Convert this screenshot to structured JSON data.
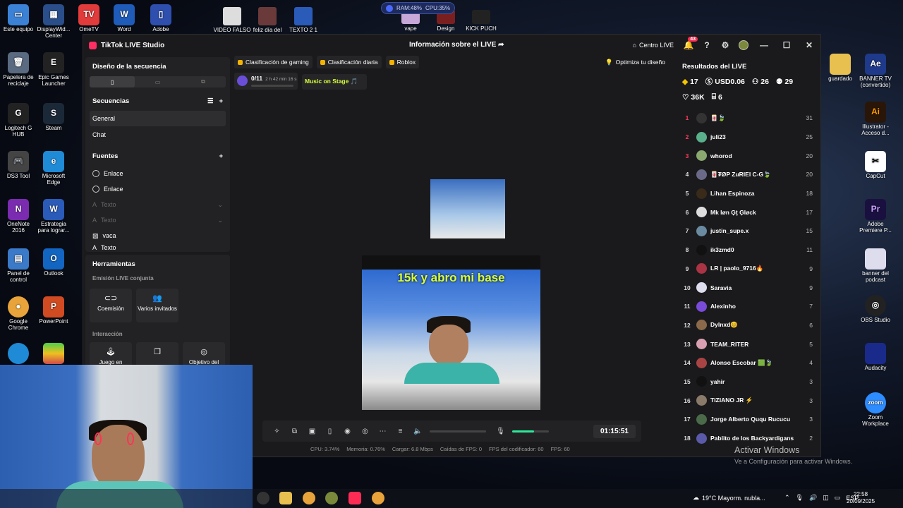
{
  "desktop": {
    "left_icons": [
      {
        "label": "Este equipo",
        "color": "#3b82d6"
      },
      {
        "label": "DisplayWid... Center",
        "color": "#2a4e8a"
      },
      {
        "label": "OmeTV",
        "color": "#e23b3b"
      },
      {
        "label": "Word",
        "color": "#1f5bb8"
      },
      {
        "label": "Adobe",
        "color": "#2e4fae"
      },
      {
        "label": "Papelera de reciclaje",
        "color": "#5a6a80"
      },
      {
        "label": "Epic Games Launcher",
        "color": "#222"
      },
      {
        "label": "Logitech G HUB",
        "color": "#222"
      },
      {
        "label": "Steam",
        "color": "#1b2838"
      },
      {
        "label": "DS3 Tool",
        "color": "#444"
      },
      {
        "label": "Microsoft Edge",
        "color": "#1f8ad6"
      },
      {
        "label": "OneNote 2016",
        "color": "#7a2bb0"
      },
      {
        "label": "Estrategia para lograr...",
        "color": "#2a5bb8"
      },
      {
        "label": "Panel de control",
        "color": "#3a7ac8"
      },
      {
        "label": "Outlook",
        "color": "#1265c0"
      },
      {
        "label": "Google Chrome",
        "color": "#e8a33a"
      },
      {
        "label": "PowerPoint",
        "color": "#d04a22"
      }
    ],
    "top_icons": [
      {
        "label": "VIDEO FALSO",
        "color": "#ddd"
      },
      {
        "label": "feliz día del",
        "color": "#6a3a3a"
      },
      {
        "label": "TEXTO 2 1",
        "color": "#2a5bb8"
      },
      {
        "label": "vape",
        "color": "#c8a8d8"
      },
      {
        "label": "Design",
        "color": "#7a1f1f"
      },
      {
        "label": "KICK PUCH",
        "color": "#222"
      }
    ],
    "right_icons": [
      {
        "label": "guardado",
        "color": "#e8c050"
      },
      {
        "label": "BANNER TV (convertido)",
        "color": "#1f3a8a"
      },
      {
        "label": "Illustrator - Acceso d...",
        "color": "#2a1608"
      },
      {
        "label": "CapCut",
        "color": "#fff"
      },
      {
        "label": "Adobe Premiere P...",
        "color": "#1a1040"
      },
      {
        "label": "banner del podcast",
        "color": "#dde"
      },
      {
        "label": "OBS Studio",
        "color": "#222"
      },
      {
        "label": "Audacity",
        "color": "#1a2a8a"
      },
      {
        "label": "Zoom Workplace",
        "color": "#2d8cff"
      }
    ],
    "monitor_widget": {
      "ram": "RAM:48%",
      "cpu": "CPU:35%"
    }
  },
  "app": {
    "title": "TikTok LIVE Studio",
    "center_title": "Información sobre el LIVE",
    "centro_live": "Centro LIVE",
    "notif_count": "43",
    "left": {
      "design_title": "Diseño de la secuencia",
      "sequences_title": "Secuencias",
      "sequences": [
        "General",
        "Chat"
      ],
      "sources_title": "Fuentes",
      "sources": [
        {
          "label": "Enlace",
          "dim": false
        },
        {
          "label": "Enlace",
          "dim": false
        },
        {
          "label": "Texto",
          "dim": true
        },
        {
          "label": "Texto",
          "dim": true
        },
        {
          "label": "vaca",
          "dim": false
        },
        {
          "label": "Texto",
          "dim": false
        }
      ],
      "tools_title": "Herramientas",
      "joint_live": "Emisión LIVE conjunta",
      "coemision": "Coemisión",
      "varios": "Varios invitados",
      "interaccion": "Interacción",
      "juego": "Juego en",
      "objetivo": "Objetivo del"
    },
    "chips": [
      "Clasificación de gaming",
      "Clasificación diaria",
      "Roblox"
    ],
    "optimiza": "Optimiza tu diseño",
    "stage": {
      "count": "0/11",
      "time": "2 h 42 min 16 s",
      "music": "Music on Stage"
    },
    "preview": {
      "caption": "15k y abro mi base"
    },
    "controls": {
      "timer": "01:15:51",
      "mic_level": 0.6
    },
    "stats": [
      "CPU: 3.74%",
      "Memoria: 0.76%",
      "Cargar: 6.8 Mbps",
      "Caídas de FPS: 0",
      "FPS del codificador: 60",
      "FPS: 60"
    ],
    "results": {
      "title": "Resultados del LIVE",
      "stats_row1": [
        {
          "icon": "diamond-icon",
          "value": "17"
        },
        {
          "icon": "dollar-icon",
          "value": "USD0.06"
        },
        {
          "icon": "viewers-icon",
          "value": "26"
        },
        {
          "icon": "new-followers-icon",
          "value": "29"
        }
      ],
      "stats_row2": [
        {
          "icon": "heart-icon",
          "value": "36K"
        },
        {
          "icon": "gift-icon",
          "value": "6"
        }
      ],
      "ranking": [
        {
          "n": "1",
          "name": "🀄️🍃",
          "score": "31",
          "color": "#333"
        },
        {
          "n": "2",
          "name": "juli23",
          "score": "25",
          "color": "#5ab08a"
        },
        {
          "n": "3",
          "name": "whorod",
          "score": "20",
          "color": "#8aa870"
        },
        {
          "n": "4",
          "name": "🀄️₮ØP ZuRIEl C-G🍃",
          "score": "20",
          "color": "#6a6a88"
        },
        {
          "n": "5",
          "name": "Lihan Espinoza",
          "score": "18",
          "color": "#3a2a1a"
        },
        {
          "n": "6",
          "name": "Mk løn Ģţ Ģløck",
          "score": "17",
          "color": "#ddd"
        },
        {
          "n": "7",
          "name": "justin_supe.x",
          "score": "15",
          "color": "#6a8aa0"
        },
        {
          "n": "8",
          "name": "ik3zmd0",
          "score": "11",
          "color": "#111"
        },
        {
          "n": "9",
          "name": "LR | paolo_9716🔥",
          "score": "9",
          "color": "#aa3344"
        },
        {
          "n": "10",
          "name": "Saravia",
          "score": "9",
          "color": "#dde"
        },
        {
          "n": "11",
          "name": "Alexinho",
          "score": "7",
          "color": "#7a4ad8"
        },
        {
          "n": "12",
          "name": "Dylnxd😊",
          "score": "6",
          "color": "#8a6a4a"
        },
        {
          "n": "13",
          "name": "TEAM_RITER",
          "score": "5",
          "color": "#d8a0b0"
        },
        {
          "n": "14",
          "name": "Alonso Escobar 🟩🍃",
          "score": "4",
          "color": "#aa4444"
        },
        {
          "n": "15",
          "name": "yahir",
          "score": "3",
          "color": "#111"
        },
        {
          "n": "16",
          "name": "TIZIANO JR ⚡",
          "score": "3",
          "color": "#8a7a6a"
        },
        {
          "n": "17",
          "name": "Jorge Alberto Ququ Rucucu",
          "score": "3",
          "color": "#4a6a4a"
        },
        {
          "n": "18",
          "name": "Pablito de los Backyardigans",
          "score": "2",
          "color": "#5a5aa8"
        }
      ]
    }
  },
  "watermark": {
    "line1": "Activar Windows",
    "line2": "Ve a Configuración para activar Windows."
  },
  "taskbar": {
    "weather": "19°C  Mayorm. nubla...",
    "lang": "ESP",
    "time": "22:58",
    "date": "20/09/2025"
  }
}
